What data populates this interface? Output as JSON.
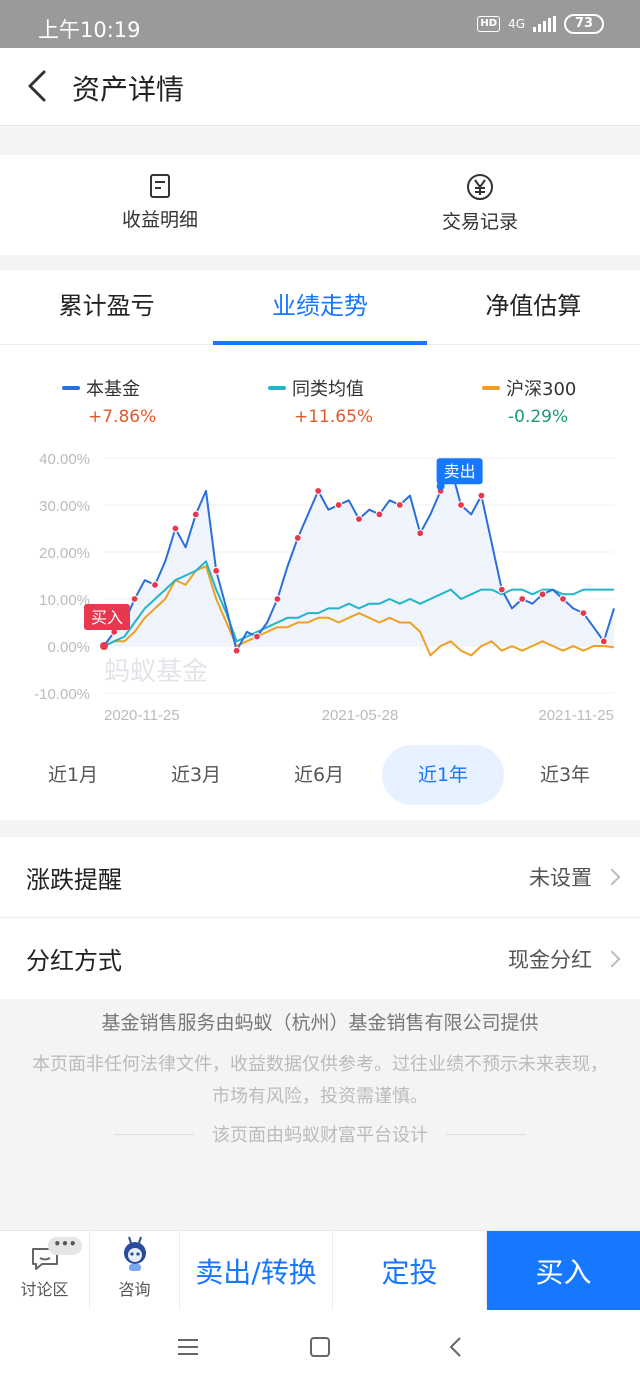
{
  "status_bar": {
    "time": "上午10:19",
    "hd": "HD",
    "network": "4G",
    "battery": "73"
  },
  "header": {
    "title": "资产详情"
  },
  "quick_actions": [
    {
      "label": "收益明细",
      "icon": "document-icon"
    },
    {
      "label": "交易记录",
      "icon": "yen-circle-icon"
    }
  ],
  "tabs": [
    {
      "label": "累计盈亏",
      "active": false
    },
    {
      "label": "业绩走势",
      "active": true
    },
    {
      "label": "净值估算",
      "active": false
    }
  ],
  "legend": [
    {
      "name": "本基金",
      "value": "+7.86%",
      "color": "#2a6fdb",
      "value_color": "#e05a2b"
    },
    {
      "name": "同类均值",
      "value": "+11.65%",
      "color": "#21b5c9",
      "value_color": "#e05a2b"
    },
    {
      "name": "沪深300",
      "value": "-0.29%",
      "color": "#f0a020",
      "value_color": "#1a9a7a"
    }
  ],
  "chart_data": {
    "type": "line",
    "y_tick_labels": [
      "40.00%",
      "30.00%",
      "20.00%",
      "10.00%",
      "0.00%",
      "-10.00%"
    ],
    "x_tick_labels": [
      "2020-11-25",
      "2021-05-28",
      "2021-11-25"
    ],
    "ylim": [
      -10,
      40
    ],
    "watermark": "蚂蚁基金",
    "buy_label": "买入",
    "sell_label": "卖出",
    "series": [
      {
        "name": "本基金",
        "color": "#2a6fdb",
        "x": [
          0,
          2,
          4,
          6,
          8,
          10,
          12,
          14,
          16,
          18,
          20,
          22,
          24,
          26,
          28,
          30,
          32,
          34,
          36,
          38,
          40,
          42,
          44,
          46,
          48,
          50,
          52,
          54,
          56,
          58,
          60,
          62,
          64,
          66,
          68,
          70,
          72,
          74,
          76,
          78,
          80,
          82,
          84,
          86,
          88,
          90,
          92,
          94,
          96,
          98,
          100
        ],
        "values": [
          0,
          3,
          5,
          10,
          14,
          13,
          18,
          25,
          21,
          28,
          33,
          16,
          8,
          -1,
          3,
          2,
          5,
          10,
          17,
          23,
          28,
          33,
          29,
          30,
          31,
          27,
          29,
          28,
          31,
          30,
          32,
          24,
          28,
          33,
          38,
          30,
          28,
          32,
          22,
          12,
          8,
          10,
          9,
          11,
          12,
          10,
          8,
          7,
          4,
          1,
          8
        ]
      },
      {
        "name": "同类均值",
        "color": "#21b5c9",
        "x": [
          0,
          2,
          4,
          6,
          8,
          10,
          12,
          14,
          16,
          18,
          20,
          22,
          24,
          26,
          28,
          30,
          32,
          34,
          36,
          38,
          40,
          42,
          44,
          46,
          48,
          50,
          52,
          54,
          56,
          58,
          60,
          62,
          64,
          66,
          68,
          70,
          72,
          74,
          76,
          78,
          80,
          82,
          84,
          86,
          88,
          90,
          92,
          94,
          96,
          98,
          100
        ],
        "values": [
          0,
          1,
          2,
          5,
          8,
          10,
          12,
          14,
          15,
          16,
          18,
          12,
          7,
          1,
          2,
          3,
          4,
          5,
          6,
          6,
          7,
          7,
          8,
          8,
          9,
          8,
          9,
          9,
          10,
          9,
          10,
          9,
          10,
          11,
          12,
          10,
          11,
          12,
          12,
          11,
          12,
          12,
          11,
          12,
          12,
          11,
          11,
          12,
          12,
          12,
          12
        ]
      },
      {
        "name": "沪深300",
        "color": "#f0a020",
        "x": [
          0,
          2,
          4,
          6,
          8,
          10,
          12,
          14,
          16,
          18,
          20,
          22,
          24,
          26,
          28,
          30,
          32,
          34,
          36,
          38,
          40,
          42,
          44,
          46,
          48,
          50,
          52,
          54,
          56,
          58,
          60,
          62,
          64,
          66,
          68,
          70,
          72,
          74,
          76,
          78,
          80,
          82,
          84,
          86,
          88,
          90,
          92,
          94,
          96,
          98,
          100
        ],
        "values": [
          0,
          1,
          1,
          3,
          6,
          8,
          10,
          14,
          13,
          16,
          17,
          10,
          5,
          0,
          1,
          2,
          3,
          4,
          4,
          5,
          5,
          6,
          6,
          5,
          6,
          7,
          6,
          5,
          6,
          5,
          5,
          3,
          -2,
          0,
          1,
          -1,
          -2,
          0,
          1,
          -1,
          0,
          -1,
          0,
          1,
          0,
          -1,
          0,
          -1,
          0,
          0,
          -0.29
        ]
      }
    ],
    "buy_marker": {
      "x": 0,
      "y": 0
    },
    "sell_marker": {
      "x": 66,
      "y": 34
    }
  },
  "periods": [
    {
      "label": "近1月",
      "active": false
    },
    {
      "label": "近3月",
      "active": false
    },
    {
      "label": "近6月",
      "active": false
    },
    {
      "label": "近1年",
      "active": true
    },
    {
      "label": "近3年",
      "active": false
    }
  ],
  "settings": [
    {
      "label": "涨跌提醒",
      "value": "未设置"
    },
    {
      "label": "分红方式",
      "value": "现金分红"
    }
  ],
  "footer": {
    "provider": "基金销售服务由蚂蚁（杭州）基金销售有限公司提供",
    "disclaimer": "本页面非任何法律文件，收益数据仅供参考。过往业绩不预示未来表现，市场有风险，投资需谨慎。",
    "design": "该页面由蚂蚁财富平台设计"
  },
  "bottom_bar": {
    "discuss": "讨论区",
    "discuss_badge": "•••",
    "consult": "咨询",
    "sell_switch": "卖出/转换",
    "auto_invest": "定投",
    "buy": "买入"
  }
}
